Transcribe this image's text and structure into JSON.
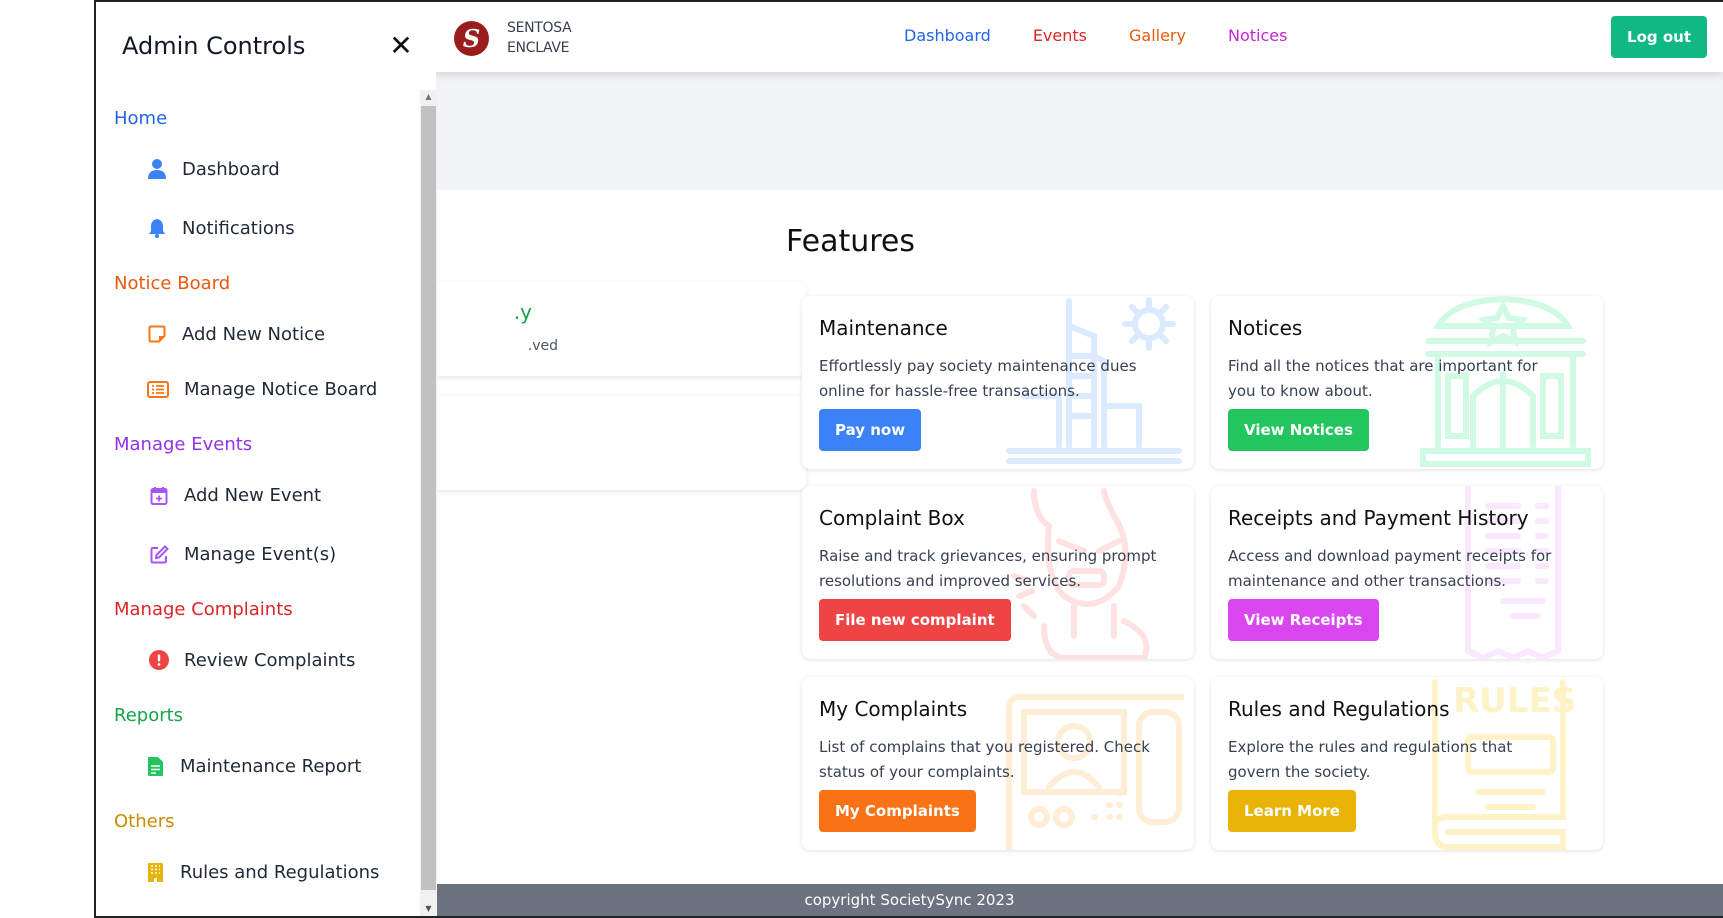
{
  "navbar": {
    "brand_line1": "SENTOSA",
    "brand_line2": "ENCLAVE",
    "brand_logo_letter": "S",
    "links": [
      {
        "label": "Dashboard",
        "color": "#2563eb"
      },
      {
        "label": "Events",
        "color": "#dc2626"
      },
      {
        "label": "Gallery",
        "color": "#ea580c"
      },
      {
        "label": "Notices",
        "color": "#c026d3"
      }
    ],
    "logout_label": "Log out",
    "logout_color": "#10b981"
  },
  "left_cards": {
    "card1_title_fragment": "y.",
    "card1_sub_fragment": "ved."
  },
  "features": {
    "title": "Features",
    "cards": [
      {
        "title": "Maintenance",
        "description": "Effortlessly pay society maintenance dues online for hassle-free transactions.",
        "button": "Pay now",
        "button_color": "#3b82f6",
        "illustration": "building-gear-icon"
      },
      {
        "title": "Notices",
        "description": "Find all the notices that are important for you to know about.",
        "button": "View Notices",
        "button_color": "#22c55e",
        "illustration": "notice-building-icon"
      },
      {
        "title": "Complaint Box",
        "description": "Raise and track grievances, ensuring prompt resolutions and improved services.",
        "button": "File new complaint",
        "button_color": "#ef4444",
        "illustration": "angry-person-icon"
      },
      {
        "title": "Receipts and Payment History",
        "description": "Access and download payment receipts for maintenance and other transactions.",
        "button": "View Receipts",
        "button_color": "#d946ef",
        "illustration": "receipt-icon"
      },
      {
        "title": "My Complaints",
        "description": "List of complains that you registered. Check status of your complaints.",
        "button": "My Complaints",
        "button_color": "#f97316",
        "illustration": "intercom-icon"
      },
      {
        "title": "Rules and Regulations",
        "description": "Explore the rules and regulations that govern the society.",
        "button": "Learn More",
        "button_color": "#eab308",
        "illustration": "rules-book-icon"
      }
    ]
  },
  "footer": {
    "text": "copyright SocietySync 2023"
  },
  "sidebar": {
    "title": "Admin Controls",
    "close_icon": "close-icon",
    "sections": [
      {
        "title": "Home",
        "color": "#2563eb",
        "items": [
          {
            "label": "Dashboard",
            "icon": "user-icon",
            "icon_color": "#3b82f6"
          },
          {
            "label": "Notifications",
            "icon": "bell-icon",
            "icon_color": "#3b82f6"
          }
        ]
      },
      {
        "title": "Notice Board",
        "color": "#ea580c",
        "items": [
          {
            "label": "Add New Notice",
            "icon": "sticky-note-icon",
            "icon_color": "#f97316"
          },
          {
            "label": "Manage Notice Board",
            "icon": "list-icon",
            "icon_color": "#f97316"
          }
        ]
      },
      {
        "title": "Manage Events",
        "color": "#9333ea",
        "items": [
          {
            "label": "Add New Event",
            "icon": "calendar-plus-icon",
            "icon_color": "#a855f7"
          },
          {
            "label": "Manage Event(s)",
            "icon": "edit-icon",
            "icon_color": "#a855f7"
          }
        ]
      },
      {
        "title": "Manage Complaints",
        "color": "#dc2626",
        "items": [
          {
            "label": "Review Complaints",
            "icon": "exclamation-circle-icon",
            "icon_color": "#ef4444"
          }
        ]
      },
      {
        "title": "Reports",
        "color": "#16a34a",
        "items": [
          {
            "label": "Maintenance Report",
            "icon": "document-icon",
            "icon_color": "#22c55e"
          }
        ]
      },
      {
        "title": "Others",
        "color": "#ca8a04",
        "items": [
          {
            "label": "Rules and Regulations",
            "icon": "building-icon",
            "icon_color": "#eab308"
          }
        ]
      }
    ]
  }
}
